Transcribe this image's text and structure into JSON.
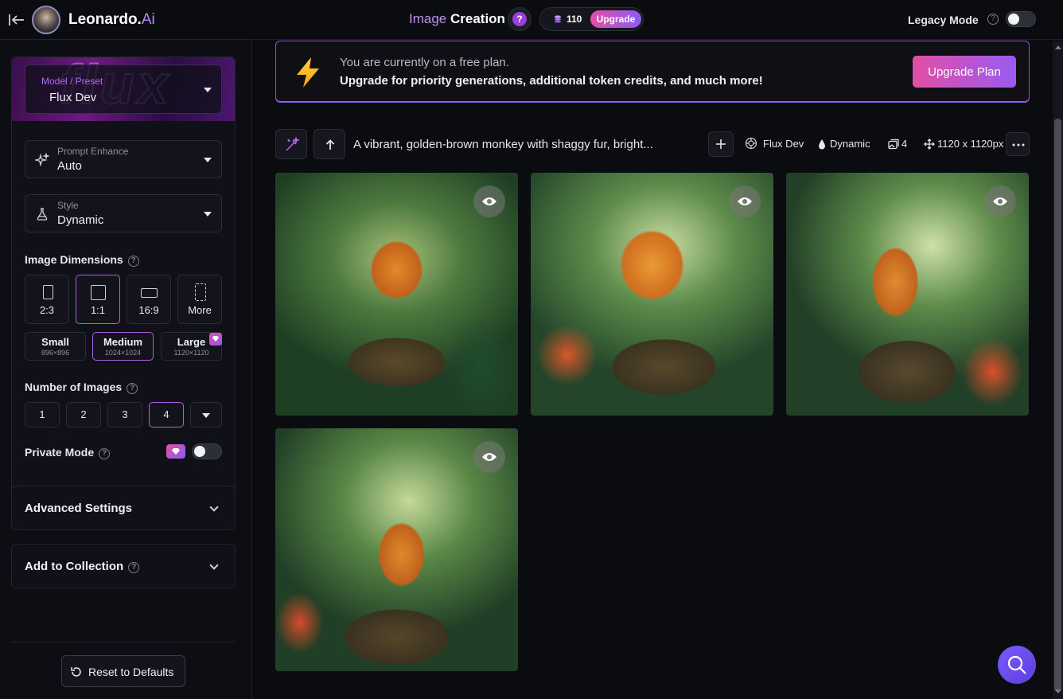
{
  "topbar": {
    "brand_main": "Leonardo.",
    "brand_accent": "Ai",
    "title_part1": "Image",
    "title_part2": "Creation",
    "help": "?",
    "token_count": "110",
    "upgrade_label": "Upgrade",
    "legacy_label": "Legacy Mode",
    "legacy_enabled": false
  },
  "sidebar": {
    "model": {
      "label": "Model / Preset",
      "value": "Flux Dev",
      "banner_text": "flux"
    },
    "prompt_enhance": {
      "label": "Prompt Enhance",
      "value": "Auto"
    },
    "style": {
      "label": "Style",
      "value": "Dynamic"
    },
    "dimensions": {
      "label": "Image Dimensions",
      "ratios": [
        "2:3",
        "1:1",
        "16:9",
        "More"
      ],
      "active_ratio": "1:1",
      "sizes": [
        {
          "name": "Small",
          "dim": "896×896"
        },
        {
          "name": "Medium",
          "dim": "1024×1024"
        },
        {
          "name": "Large",
          "dim": "1120×1120"
        }
      ],
      "active_size": "Medium"
    },
    "num_images": {
      "label": "Number of Images",
      "options": [
        "1",
        "2",
        "3",
        "4"
      ],
      "active": "4"
    },
    "private_mode": {
      "label": "Private Mode",
      "enabled": false
    },
    "advanced_settings": "Advanced Settings",
    "add_to_collection": "Add to Collection",
    "reset_label": "Reset to Defaults"
  },
  "banner": {
    "line1": "You are currently on a free plan.",
    "line2": "Upgrade for priority generations, additional token credits, and much more!",
    "button": "Upgrade Plan"
  },
  "generation": {
    "prompt": "A vibrant, golden-brown monkey with shaggy fur, bright...",
    "model": "Flux Dev",
    "style": "Dynamic",
    "count": "4",
    "dimensions": "1120 x 1120px"
  },
  "colors": {
    "accent_purple": "#b05ee8",
    "accent_pink": "#e24ea4",
    "background": "#0b0c10"
  }
}
